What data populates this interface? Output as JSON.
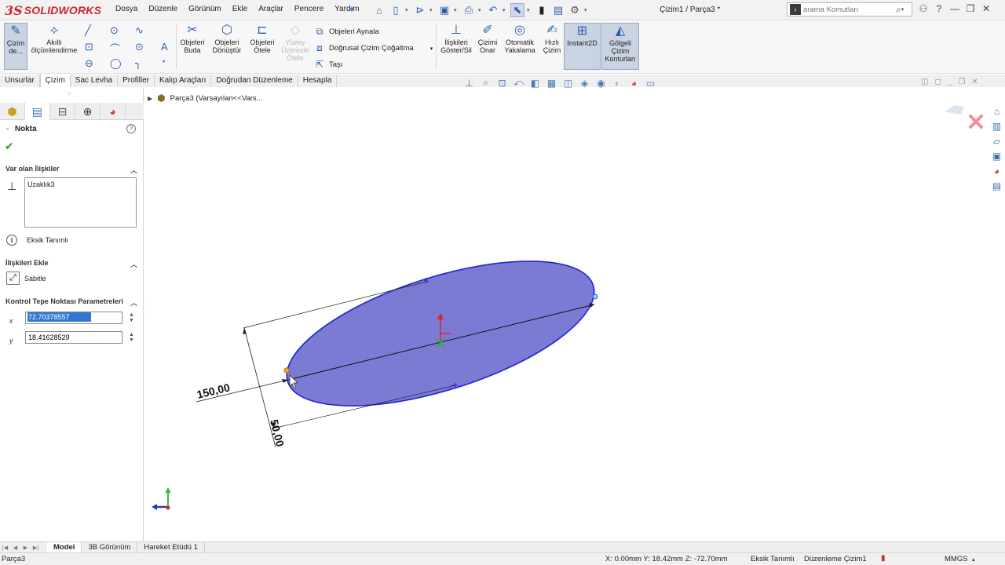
{
  "app": {
    "logo_mark": "3S",
    "logo_name": "SOLIDWORKS",
    "doc_title": "Çizim1 / Parça3 *"
  },
  "menu": [
    "Dosya",
    "Düzenle",
    "Görünüm",
    "Ekle",
    "Araçlar",
    "Pencere",
    "Yardım"
  ],
  "search": {
    "placeholder": "arama Komutları"
  },
  "ribbon": {
    "sketch_btn": "Çizim de...",
    "smart_dim": "Akıllı ölçümlendirme",
    "trim": "Objeleri Buda",
    "convert": "Objeleri Dönüştür",
    "offset": "Objeleri Ötele",
    "surface_offset": "Yüzey Üzerinde Ötele",
    "mirror": "Objeleri Aynala",
    "linear_pattern": "Doğrusal Çizim Çoğaltma",
    "move": "Taşı",
    "relations": "İlişkileri Göster/Sil",
    "repair": "Çizimi Onar",
    "quick_snaps": "Otomatik Yakalama",
    "rapid_sketch": "Hızlı Çizim",
    "instant2d": "Instant2D",
    "shaded_contours": "Gölgeli Çizim Konturları"
  },
  "cmd_tabs": [
    "Unsurlar",
    "Çizim",
    "Sac Levha",
    "Profiller",
    "Kalıp Araçları",
    "Doğrudan Düzenleme",
    "Hesapla"
  ],
  "cmd_tab_active": "Çizim",
  "property_manager": {
    "title": "Nokta",
    "existing_relations_header": "Var olan İlişkiler",
    "relations": [
      "Uzaklık3"
    ],
    "status_text": "Eksik Tanımlı",
    "add_relations_header": "İlişkileri Ekle",
    "fix_label": "Sabitle",
    "params_header": "Kontrol Tepe Noktası Parametreleri",
    "x_label": "x",
    "x_value": "72.70378557",
    "y_label": "y",
    "y_value": "18.41628529"
  },
  "tree": {
    "item": "Parça3  (Varsayılan<<Vars..."
  },
  "sketch": {
    "dim_major": "150,00",
    "dim_minor": "50,00",
    "fill_color": "#7b7bd4",
    "stroke_color": "#1d22d8"
  },
  "bottom_tabs": [
    "Model",
    "3B Görünüm",
    "Hareket Etüdü 1"
  ],
  "status": {
    "left": "Parça3",
    "coords": "X: 0.00mm Y: 18.42mm Z: -72.70mm",
    "definition": "Eksik Tanımlı",
    "mode": "Düzenleme Çizim1",
    "units": "MMGS"
  }
}
